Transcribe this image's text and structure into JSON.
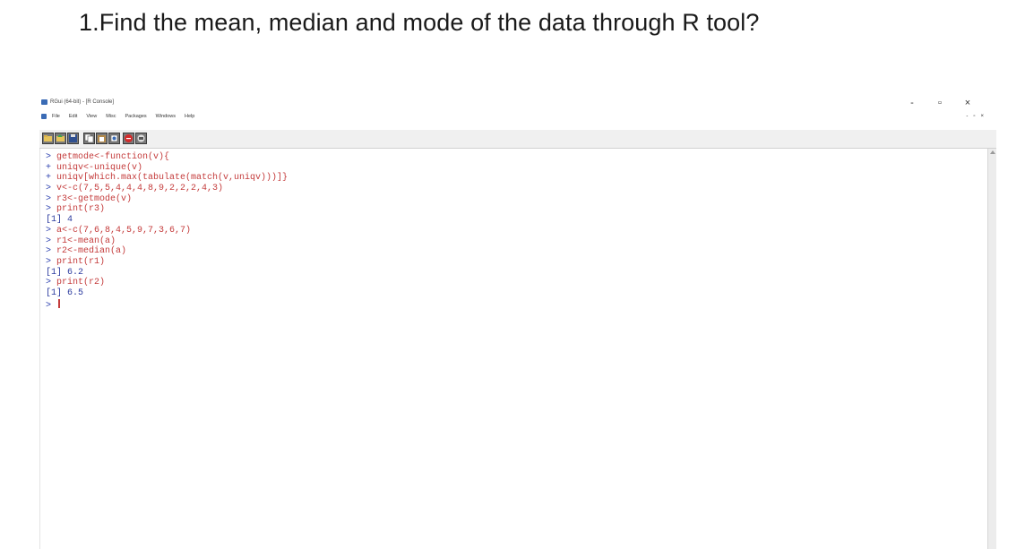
{
  "slide": {
    "title": "1.Find the mean, median and mode of the data through R tool?"
  },
  "window": {
    "title": "RGui (64-bit) - [R Console]",
    "controls": {
      "minimize": "-",
      "restore": "▫",
      "close": "×"
    }
  },
  "menubar": {
    "items": [
      "File",
      "Edit",
      "View",
      "Misc",
      "Packages",
      "Windows",
      "Help"
    ],
    "console_controls": {
      "minimize": "-",
      "restore": "▫",
      "close": "×"
    }
  },
  "toolbar": {
    "buttons": [
      "open-script",
      "load-workspace",
      "save-workspace",
      "copy",
      "paste",
      "copy-paste",
      "stop",
      "print"
    ]
  },
  "console": {
    "lines": [
      {
        "kind": "prompt",
        "sym": ">",
        "text": "getmode<-function(v){"
      },
      {
        "kind": "prompt",
        "sym": "+",
        "text": "uniqv<-unique(v)"
      },
      {
        "kind": "prompt",
        "sym": "+",
        "text": "uniqv[which.max(tabulate(match(v,uniqv)))]}"
      },
      {
        "kind": "prompt",
        "sym": ">",
        "text": "v<-c(7,5,5,4,4,4,8,9,2,2,2,4,3)"
      },
      {
        "kind": "prompt",
        "sym": ">",
        "text": "r3<-getmode(v)"
      },
      {
        "kind": "prompt",
        "sym": ">",
        "text": "print(r3)"
      },
      {
        "kind": "output",
        "sym": "",
        "text": "[1] 4"
      },
      {
        "kind": "prompt",
        "sym": ">",
        "text": "a<-c(7,6,8,4,5,9,7,3,6,7)"
      },
      {
        "kind": "prompt",
        "sym": ">",
        "text": "r1<-mean(a)"
      },
      {
        "kind": "prompt",
        "sym": ">",
        "text": "r2<-median(a)"
      },
      {
        "kind": "prompt",
        "sym": ">",
        "text": "print(r1)"
      },
      {
        "kind": "output",
        "sym": "",
        "text": "[1] 6.2"
      },
      {
        "kind": "prompt",
        "sym": ">",
        "text": "print(r2)"
      },
      {
        "kind": "output",
        "sym": "",
        "text": "[1] 6.5"
      },
      {
        "kind": "cursor",
        "sym": ">",
        "text": ""
      }
    ]
  },
  "colors": {
    "prompt": "#2b3fae",
    "code": "#c43b3b",
    "output": "#2a3a9e"
  }
}
